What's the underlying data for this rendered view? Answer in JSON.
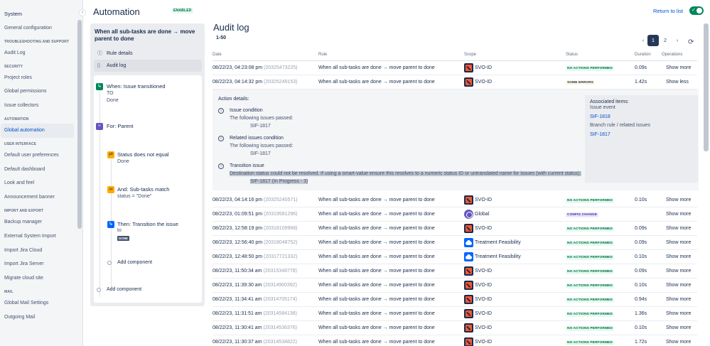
{
  "sidebar": {
    "title": "System",
    "groups": [
      {
        "heading": "",
        "items": [
          "General configuration"
        ]
      },
      {
        "heading": "TROUBLESHOOTING AND SUPPORT",
        "items": [
          "Audit Log"
        ]
      },
      {
        "heading": "SECURITY",
        "items": [
          "Project roles",
          "Global permissions",
          "Issue collectors"
        ]
      },
      {
        "heading": "AUTOMATION",
        "items": [
          "Global automation"
        ]
      },
      {
        "heading": "USER INTERFACE",
        "items": [
          "Default user preferences",
          "Default dashboard",
          "Look and feel",
          "Announcement banner"
        ]
      },
      {
        "heading": "IMPORT AND EXPORT",
        "items": [
          "Backup manager",
          "External System Import",
          "Import Jira Cloud",
          "Import Jira Server",
          "Migrate cloud site"
        ]
      },
      {
        "heading": "MAIL",
        "items": [
          "Global Mail Settings",
          "Outgoing Mail"
        ]
      }
    ],
    "active_item": "Global automation"
  },
  "header": {
    "title": "Automation",
    "badge": "ENABLED",
    "return_link": "Return to list",
    "toggle_on": true
  },
  "rule": {
    "name": "When all sub-tasks are done → move parent to done",
    "menu": [
      {
        "label": "Rule details",
        "icon": "info-icon"
      },
      {
        "label": "Audit log",
        "icon": "document-icon"
      }
    ],
    "components": [
      {
        "title": "When: Issue transitioned",
        "sub1": "TO",
        "sub2": "Done",
        "icon": "transition-icon",
        "color": "#00875a"
      },
      {
        "title": "For: Parent",
        "icon": "branch-icon",
        "color": "#6554c0"
      },
      {
        "title": "Status does not equal",
        "sub1": "Done",
        "icon": "shuffle-icon",
        "color": "#ffab00"
      },
      {
        "title": "And: Sub-tasks match",
        "sub1": "status = \"Done\"",
        "icon": "link-icon",
        "color": "#ffab00"
      },
      {
        "title": "Then: Transition the issue",
        "sub1": "to",
        "lozenge": "DONE",
        "icon": "transition-icon",
        "color": "#0065ff"
      }
    ],
    "add_component_inner": "Add component",
    "add_component_outer": "Add component"
  },
  "audit": {
    "title": "Audit log",
    "range": "1-50",
    "pages": [
      "1",
      "2"
    ],
    "current_page": "1",
    "columns": [
      "Date",
      "Rule",
      "Scope",
      "Status",
      "Duration",
      "Operations"
    ],
    "colors": {
      "no_actions": "#e3fcef",
      "some_errors": "#fffae6",
      "config_change": "#eae6ff"
    },
    "rows": [
      {
        "date": "08/22/23, 04:23:08 pm",
        "id": "(20325473225)",
        "rule": "When all sub-tasks are done → move parent to done",
        "scope": "SVO-ID",
        "scope_icon": "proj",
        "status": "NO ACTIONS PERFORMED",
        "status_kind": "none",
        "duration": "0.09s",
        "op": "Show more"
      },
      {
        "date": "08/22/23, 04:14:32 pm",
        "id": "(20325249153)",
        "rule": "When all sub-tasks are done → move parent to done",
        "scope": "SVO-ID",
        "scope_icon": "proj",
        "status": "SOME ERRORS",
        "status_kind": "err",
        "duration": "1.42s",
        "op": "Show less"
      },
      {
        "date": "08/22/23, 04:14:16 pm",
        "id": "(20325240571)",
        "rule": "When all sub-tasks are done → move parent to done",
        "scope": "SVO-ID",
        "scope_icon": "proj",
        "status": "NO ACTIONS PERFORMED",
        "status_kind": "none",
        "duration": "0.10s",
        "op": "Show more"
      },
      {
        "date": "08/22/23, 01:09:51 pm",
        "id": "(20319581296)",
        "rule": "When all sub-tasks are done → move parent to done",
        "scope": "Global",
        "scope_icon": "glob",
        "status": "CONFIG CHANGE",
        "status_kind": "cfg",
        "duration": "",
        "op": "Show more"
      },
      {
        "date": "08/22/23, 12:58:19 pm",
        "id": "(20318109968)",
        "rule": "When all sub-tasks are done → move parent to done",
        "scope": "SVO-ID",
        "scope_icon": "proj",
        "status": "NO ACTIONS PERFORMED",
        "status_kind": "none",
        "duration": "0.09s",
        "op": "Show more"
      },
      {
        "date": "08/22/23, 12:56:40 pm",
        "id": "(20318048752)",
        "rule": "When all sub-tasks are done → move parent to done",
        "scope": "Treatment Feasibility",
        "scope_icon": "cloud",
        "status": "NO ACTIONS PERFORMED",
        "status_kind": "none",
        "duration": "0.09s",
        "op": "Show more"
      },
      {
        "date": "08/22/23, 12:48:50 pm",
        "id": "(20317721332)",
        "rule": "When all sub-tasks are done → move parent to done",
        "scope": "Treatment Feasibility",
        "scope_icon": "cloud",
        "status": "NO ACTIONS PERFORMED",
        "status_kind": "none",
        "duration": "0.10s",
        "op": "Show more"
      },
      {
        "date": "08/22/23, 11:50:34 am",
        "id": "(20315348778)",
        "rule": "When all sub-tasks are done → move parent to done",
        "scope": "SVO-ID",
        "scope_icon": "proj",
        "status": "NO ACTIONS PERFORMED",
        "status_kind": "none",
        "duration": "0.09s",
        "op": "Show more"
      },
      {
        "date": "08/22/23, 11:39:30 am",
        "id": "(20314900392)",
        "rule": "When all sub-tasks are done → move parent to done",
        "scope": "SVO-ID",
        "scope_icon": "proj",
        "status": "NO ACTIONS PERFORMED",
        "status_kind": "none",
        "duration": "0.10s",
        "op": "Show more"
      },
      {
        "date": "08/22/23, 11:34:41 am",
        "id": "(20314705174)",
        "rule": "When all sub-tasks are done → move parent to done",
        "scope": "SVO-ID",
        "scope_icon": "proj",
        "status": "NO ACTIONS PERFORMED",
        "status_kind": "none",
        "duration": "0.94s",
        "op": "Show more"
      },
      {
        "date": "08/22/23, 11:31:51 am",
        "id": "(20314584138)",
        "rule": "When all sub-tasks are done → move parent to done",
        "scope": "SVO-ID",
        "scope_icon": "proj",
        "status": "NO ACTIONS PERFORMED",
        "status_kind": "none",
        "duration": "1.36s",
        "op": "Show more"
      },
      {
        "date": "08/22/23, 11:30:41 am",
        "id": "(20314536376)",
        "rule": "When all sub-tasks are done → move parent to done",
        "scope": "SVO-ID",
        "scope_icon": "proj",
        "status": "NO ACTIONS PERFORMED",
        "status_kind": "none",
        "duration": "0.10s",
        "op": "Show more"
      },
      {
        "date": "08/22/23, 11:30:37 am",
        "id": "(20314534822)",
        "rule": "When all sub-tasks are done → move parent to done",
        "scope": "SVO-ID",
        "scope_icon": "proj",
        "status": "NO ACTIONS PERFORMED",
        "status_kind": "none",
        "duration": "1.72s",
        "op": "Show more"
      }
    ],
    "details": {
      "title": "Action details:",
      "actions": [
        {
          "title": "Issue condition",
          "line": "The following issues passed:",
          "key": "SIF-1817"
        },
        {
          "title": "Related issues condition",
          "line": "The following issues passed:",
          "key": "SIF-1817"
        },
        {
          "title": "Transition issue",
          "line": "Destination status could not be resolved. If using a smart-value ensure this resolves to a numeric status ID or untranslated name for issues (with current status):",
          "key": "SIF-1817 (In Progress - 3)"
        }
      ],
      "assoc_title": "Associated items:",
      "assoc_event": "Issue event",
      "assoc_link1": "SIF-1818",
      "assoc_branch": "Branch rule / related issues",
      "assoc_link2": "SIF-1817"
    }
  }
}
